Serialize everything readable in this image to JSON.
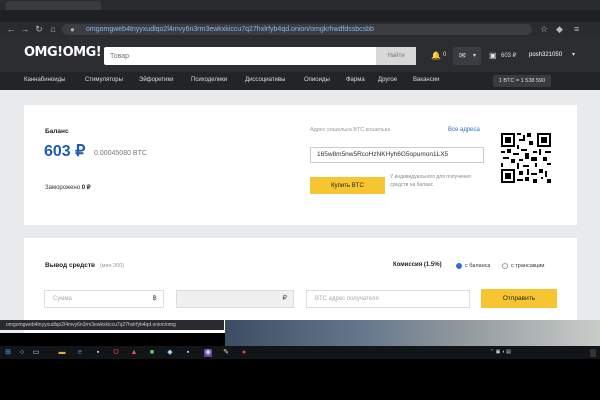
{
  "browser": {
    "url": "omgomgweb4tnyyxudlqo2l4mvy6n3rm3ewkxkiccu7q27hxlrfyb4qd.onion/omgkrhwdfdssbcsbb"
  },
  "header": {
    "logo": "OMG!OMG!",
    "search_placeholder": "Товар",
    "search_button": "Найти",
    "notif_count": "0",
    "cart_total": "603 ₽",
    "username": "posh321050"
  },
  "nav": {
    "items": [
      "Каннабиноиды",
      "Стимуляторы",
      "Эйфоретики",
      "Психоделики",
      "Диссоциативы",
      "Опиоиды",
      "Фарма",
      "Другое",
      "Вакансии"
    ],
    "rate": "1 BTC = 1 538 590"
  },
  "balance": {
    "label": "Баланс",
    "rub": "603 ₽",
    "btc": "0.00045080 BTC",
    "frozen_label": "Заморожено",
    "frozen_value": "0 ₽",
    "address_label": "Адрес кошелька BTC кошелька",
    "all_addresses": "Все адреса",
    "address": "165w8m5nw5RcoHzNKHyh6G5opumon1LX5",
    "buy_button": "Купить BTC",
    "note": "У индивидуального для получения средств на баланс"
  },
  "withdraw": {
    "title": "Вывод средств",
    "min_note": "(мин 300)",
    "fee_label": "Комиссия (1.5%)",
    "option_balance": "с баланса",
    "option_transfer": "с трансакции",
    "amount_placeholder": "Сумма",
    "btc_symbol": "฿",
    "rub_symbol": "₽",
    "address_placeholder": "BTC адрес получателя",
    "send_button": "Отправить"
  },
  "status_bar": {
    "link": "omgomgweb4tnyyxudlqo2l4mvy6n3rm3ewkxkiccu7q27hxlrfyb4qd.onion/omg"
  }
}
